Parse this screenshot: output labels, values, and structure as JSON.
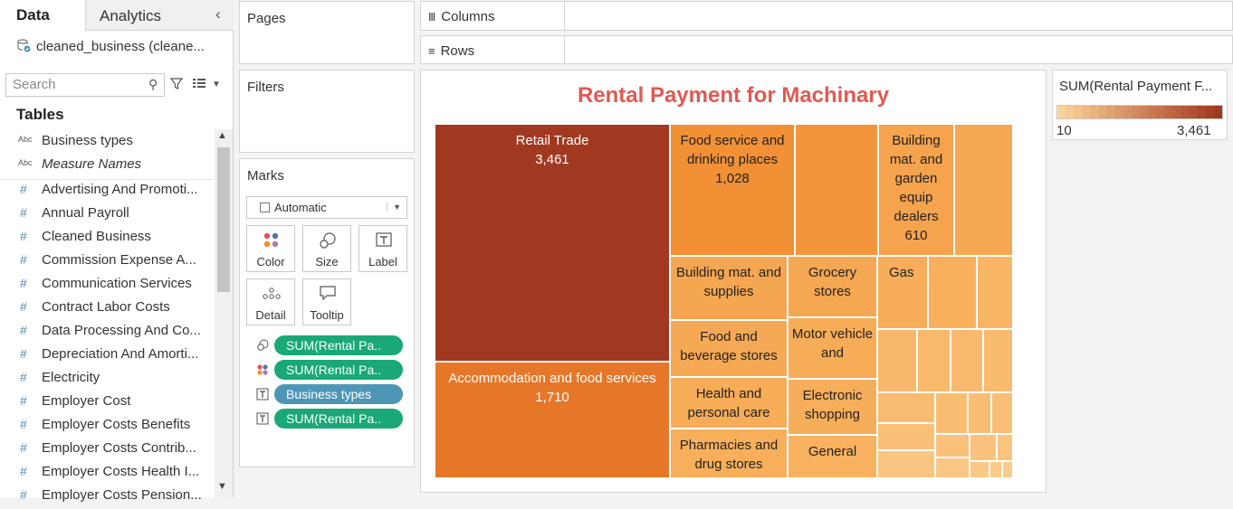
{
  "left_pane": {
    "tabs": [
      "Data",
      "Analytics"
    ],
    "data_source": "cleaned_business (cleane...",
    "search_placeholder": "Search",
    "tables_title": "Tables",
    "dimensions": [
      {
        "type": "Abc",
        "label": "Business types",
        "italic": false
      },
      {
        "type": "Abc",
        "label": "Measure Names",
        "italic": true
      }
    ],
    "measures": [
      "Advertising And Promoti...",
      "Annual Payroll",
      "Cleaned Business",
      "Commission Expense A...",
      "Communication Services",
      "Contract Labor Costs",
      "Data Processing And Co...",
      "Depreciation And Amorti...",
      "Electricity",
      "Employer Cost",
      "Employer Costs Benefits",
      "Employer Costs Contrib...",
      "Employer Costs Health I...",
      "Employer Costs Pension..."
    ]
  },
  "cards": {
    "pages": "Pages",
    "filters": "Filters",
    "marks": "Marks",
    "mark_type": "Automatic",
    "mark_buttons": [
      {
        "name": "color",
        "label": "Color",
        "icon": "color-dots-icon"
      },
      {
        "name": "size",
        "label": "Size",
        "icon": "size-circles-icon"
      },
      {
        "name": "label",
        "label": "Label",
        "icon": "label-T-icon"
      },
      {
        "name": "detail",
        "label": "Detail",
        "icon": "detail-dots-icon"
      },
      {
        "name": "tooltip",
        "label": "Tooltip",
        "icon": "tooltip-bubble-icon"
      }
    ],
    "pills": [
      {
        "icon": "size-icon",
        "label": "SUM(Rental Pa..",
        "color": "#1aa876"
      },
      {
        "icon": "color-icon",
        "label": "SUM(Rental Pa..",
        "color": "#1aa876"
      },
      {
        "icon": "label-icon",
        "label": "Business types",
        "color": "#4e96b6"
      },
      {
        "icon": "label-icon",
        "label": "SUM(Rental Pa..",
        "color": "#1aa876"
      }
    ]
  },
  "shelves": {
    "columns": "Columns",
    "rows": "Rows"
  },
  "legend": {
    "title": "SUM(Rental Payment F...",
    "min": "10",
    "max": "3,461",
    "color_low": "#fcd39a",
    "color_high": "#a0391f"
  },
  "chart_data": {
    "type": "treemap",
    "title": "Rental Payment for Machinary",
    "measure": "SUM(Rental Payment for Machinary)",
    "color_range": [
      10,
      3461
    ],
    "tiles": [
      {
        "label": "Retail Trade",
        "value_label": "3,461",
        "value": 3461
      },
      {
        "label": "Accommodation and food services",
        "value_label": "1,710",
        "value": 1710
      },
      {
        "label": "Food service and drinking places",
        "value_label": "1,028",
        "value": 1028
      },
      {
        "label": "",
        "value_label": "",
        "value": 900
      },
      {
        "label": "Building mat. and garden equip dealers",
        "value_label": "610",
        "value": 610
      },
      {
        "label": "",
        "value_label": "",
        "value": 530
      },
      {
        "label": "Building mat. and supplies",
        "value_label": "",
        "value": 560
      },
      {
        "label": "Grocery stores",
        "value_label": "",
        "value": 530
      },
      {
        "label": "Gas",
        "value_label": "",
        "value": 430
      },
      {
        "label": "",
        "value_label": "",
        "value": 380
      },
      {
        "label": "",
        "value_label": "",
        "value": 300
      },
      {
        "label": "Food and beverage stores",
        "value_label": "",
        "value": 500
      },
      {
        "label": "Motor vehicle and",
        "value_label": "",
        "value": 450
      },
      {
        "label": "Health and personal care",
        "value_label": "",
        "value": 450
      },
      {
        "label": "Electronic shopping",
        "value_label": "",
        "value": 420
      },
      {
        "label": "Pharmacies and drug stores",
        "value_label": "",
        "value": 400
      },
      {
        "label": "General",
        "value_label": "",
        "value": 370
      }
    ]
  }
}
